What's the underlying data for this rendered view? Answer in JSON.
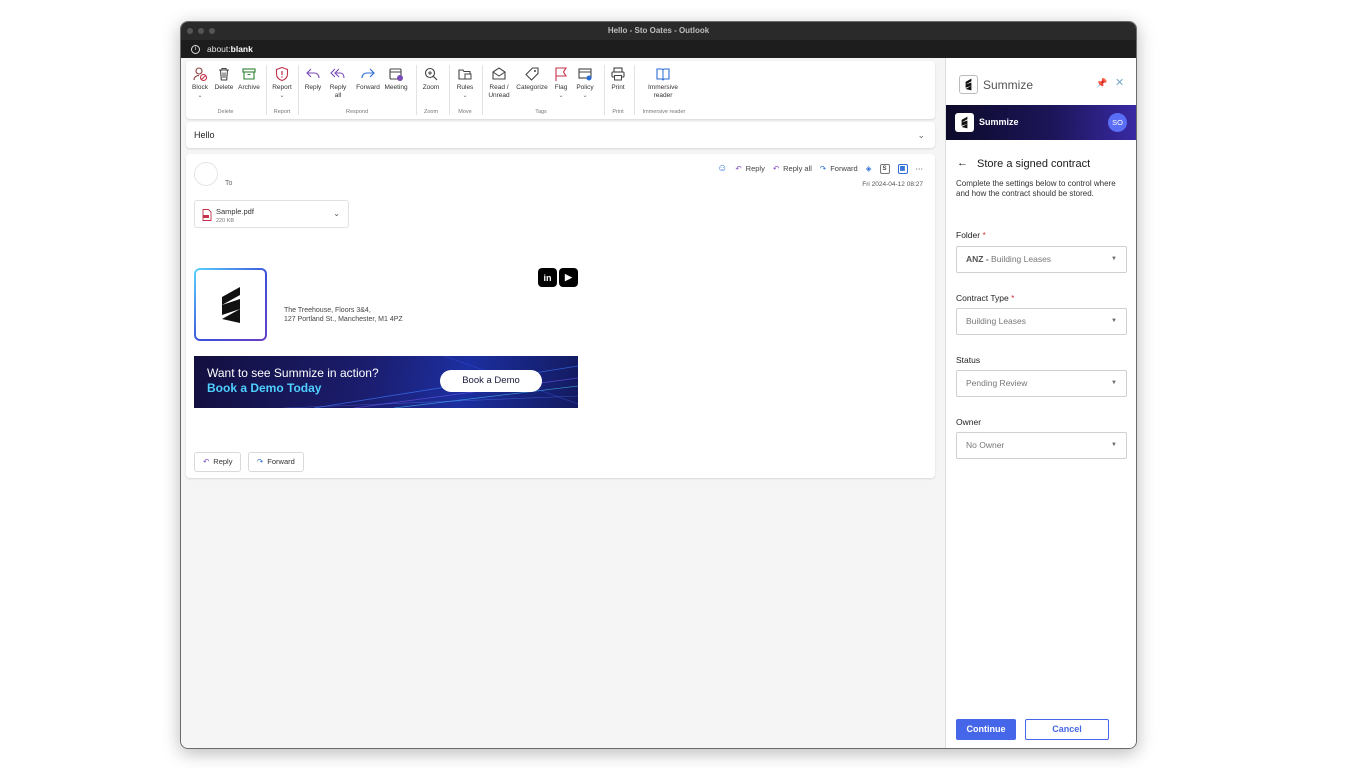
{
  "window": {
    "title": "Hello - Sto Oates - Outlook"
  },
  "address": {
    "prefix": "about:",
    "host": "blank"
  },
  "ribbon": {
    "buttons": [
      {
        "label": "Block",
        "icon": "block-icon"
      },
      {
        "label": "Delete",
        "icon": "trash-icon"
      },
      {
        "label": "Archive",
        "icon": "archive-icon"
      },
      {
        "label": "Report",
        "icon": "shield-icon"
      },
      {
        "label": "Reply",
        "icon": "reply-icon"
      },
      {
        "label": "Reply all",
        "icon": "reply-all-icon"
      },
      {
        "label": "Forward",
        "icon": "forward-icon"
      },
      {
        "label": "Meeting",
        "icon": "meeting-icon"
      },
      {
        "label": "Zoom",
        "icon": "zoom-icon"
      },
      {
        "label": "Rules",
        "icon": "rules-icon"
      },
      {
        "label": "Read / Unread",
        "icon": "envelope-icon"
      },
      {
        "label": "Categorize",
        "icon": "tag-icon"
      },
      {
        "label": "Flag",
        "icon": "flag-icon"
      },
      {
        "label": "Policy",
        "icon": "policy-icon"
      },
      {
        "label": "Print",
        "icon": "printer-icon"
      },
      {
        "label": "Immersive reader",
        "icon": "immersive-reader-icon"
      }
    ],
    "groups": [
      "Delete",
      "Report",
      "Respond",
      "Zoom",
      "Move",
      "Tags",
      "Print",
      "Immersive reader"
    ]
  },
  "subject": "Hello",
  "message": {
    "to_label": "To",
    "actions": {
      "reply": "Reply",
      "reply_all": "Reply all",
      "forward": "Forward"
    },
    "date": "Fri 2024-04-12 08:27",
    "attachment": {
      "name": "Sample.pdf",
      "size": "220 KB"
    },
    "signature": {
      "address_line1": "The Treehouse, Floors 3&4,",
      "address_line2": "127 Portland St., Manchester, M1 4PZ"
    },
    "banner": {
      "line1": "Want to see Summize in action?",
      "line2": "Book a Demo Today",
      "cta": "Book a Demo"
    },
    "bottom_reply": "Reply",
    "bottom_forward": "Forward"
  },
  "pane": {
    "app_name": "Summize",
    "brand_name": "Summize",
    "user_initials": "SO",
    "title": "Store a signed contract",
    "description": "Complete the settings below to control where and how the contract should be stored.",
    "fields": {
      "folder": {
        "label": "Folder",
        "value_prefix": "ANZ -",
        "value": " Building Leases"
      },
      "contract_type": {
        "label": "Contract Type",
        "value": "Building Leases"
      },
      "status": {
        "label": "Status",
        "value": "Pending Review"
      },
      "owner": {
        "label": "Owner",
        "value": "No Owner"
      }
    },
    "continue_label": "Continue",
    "cancel_label": "Cancel"
  },
  "colors": {
    "accent": "#4566e8",
    "brand_bar": "#1c1558",
    "required": "#d13438",
    "banner_highlight": "#4fd0ff"
  }
}
